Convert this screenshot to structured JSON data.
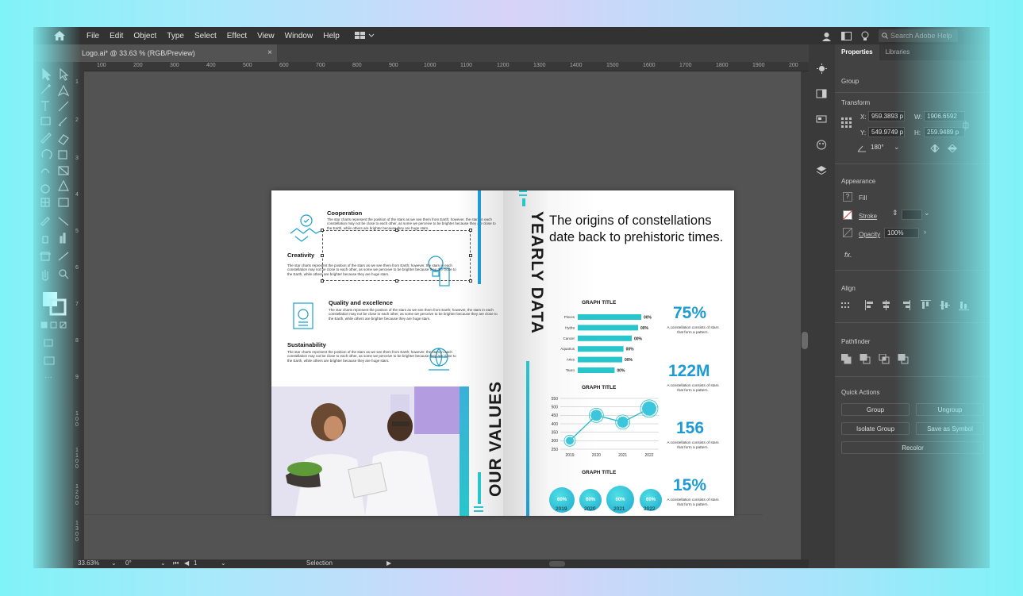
{
  "menubar": {
    "items": [
      "File",
      "Edit",
      "Object",
      "Type",
      "Select",
      "Effect",
      "View",
      "Window",
      "Help"
    ],
    "search_placeholder": "Search Adobe Help"
  },
  "document_tab": {
    "title": "Logo.ai* @ 33.63 % (RGB/Preview)",
    "close": "×"
  },
  "ruler_h": [
    "100",
    "200",
    "300",
    "400",
    "500",
    "600",
    "700",
    "800",
    "900",
    "1000",
    "1100",
    "1200",
    "1300",
    "1400",
    "1500",
    "1600",
    "1700",
    "1800",
    "1900",
    "200"
  ],
  "ruler_v": [
    "1",
    "2",
    "3",
    "4",
    "5",
    "6",
    "7",
    "8",
    "9",
    "1 0 0",
    "1 1 0 0",
    "1 2 0 0",
    "1 3 0 0",
    "1 4 0 0"
  ],
  "statusbar": {
    "zoom": "33.63%",
    "rotation": "0°",
    "artboard": "1",
    "tool": "Selection"
  },
  "panel": {
    "tabs": [
      "Properties",
      "Libraries"
    ],
    "group_label": "Group",
    "transform_label": "Transform",
    "x_label": "X:",
    "x_value": "959.3893 p",
    "y_label": "Y:",
    "y_value": "549.9749 p",
    "w_label": "W:",
    "w_value": "1906.6592",
    "h_label": "H:",
    "h_value": "259.9489 p",
    "angle_value": "180°",
    "appearance_label": "Appearance",
    "fill_label": "Fill",
    "stroke_label": "Stroke",
    "opacity_label": "Opacity",
    "opacity_value": "100%",
    "fx_label": "fx.",
    "align_label": "Align",
    "pathfinder_label": "Pathfinder",
    "quick_actions_label": "Quick Actions",
    "btn_group": "Group",
    "btn_ungroup": "Ungroup",
    "btn_isolate": "Isolate Group",
    "btn_save_symbol": "Save as Symbol",
    "btn_recolor": "Recolor"
  },
  "left_page": {
    "values": [
      {
        "title": "Cooperation",
        "text": "The star charts represent the position of the stars as we see them from Earth; however, the stars in each constellation may not be close to each other, as some we perceive to be brighter because they are close to the Earth, while others are brighter because they are huge stars."
      },
      {
        "title": "Creativity",
        "text": "The star charts represent the position of the stars as we see them from Earth; however, the stars in each constellation may not be close to each other, as some we perceive to be brighter because they are close to the Earth, while others are brighter because they are huge stars."
      },
      {
        "title": "Quality and excellence",
        "text": "The star charts represent the position of the stars as we see them from Earth; however, the stars in each constellation may not be close to each other, as some we perceive to be brighter because they are close to the Earth, while others are brighter because they are huge stars."
      },
      {
        "title": "Sustainability",
        "text": "The star charts represent the position of the stars as we see them from Earth; however, the stars in each constellation may not be close to each other, as some we perceive to be brighter because they are close to the Earth, while others are brighter because they are huge stars."
      }
    ],
    "vertical_title": "OUR VALUES"
  },
  "right_page": {
    "vertical_title": "YEARLY DATA",
    "headline": "The origins of constellations date back to prehistoric times.",
    "graph1_title": "GRAPH TITLE",
    "graph2_title": "GRAPH TITLE",
    "graph3_title": "GRAPH TITLE",
    "stats": [
      {
        "value": "75%",
        "text": "A constellation consists of stars that form a pattern."
      },
      {
        "value": "122M",
        "text": "A constellation consists of stars that form a pattern."
      },
      {
        "value": "156",
        "text": "A constellation consists of stars that form a pattern."
      },
      {
        "value": "15%",
        "text": "A constellation consists of stars that form a pattern."
      }
    ]
  },
  "chart_data": [
    {
      "type": "bar",
      "orientation": "horizontal",
      "title": "GRAPH TITLE",
      "categories": [
        "Pisces",
        "Hydra",
        "Cancer",
        "Aquarius",
        "Aries",
        "Tauro"
      ],
      "values": [
        100,
        95,
        85,
        72,
        70,
        58
      ],
      "labels": [
        "00%",
        "00%",
        "00%",
        "00%",
        "00%",
        "00%"
      ]
    },
    {
      "type": "line",
      "title": "GRAPH TITLE",
      "x": [
        "2019",
        "2020",
        "2021",
        "2022"
      ],
      "y": [
        300,
        450,
        410,
        490
      ],
      "yticks": [
        "550",
        "500",
        "450",
        "400",
        "350",
        "300",
        "250"
      ],
      "ylim": [
        250,
        550
      ]
    },
    {
      "type": "bubble",
      "title": "GRAPH TITLE",
      "categories": [
        "2019",
        "2020",
        "2021",
        "2022"
      ],
      "labels": [
        "60%",
        "60%",
        "60%",
        "60%"
      ]
    }
  ],
  "colors": {
    "accent": "#27c6cc",
    "stat_blue": "#1e9bd7",
    "app_bg": "#535353"
  }
}
